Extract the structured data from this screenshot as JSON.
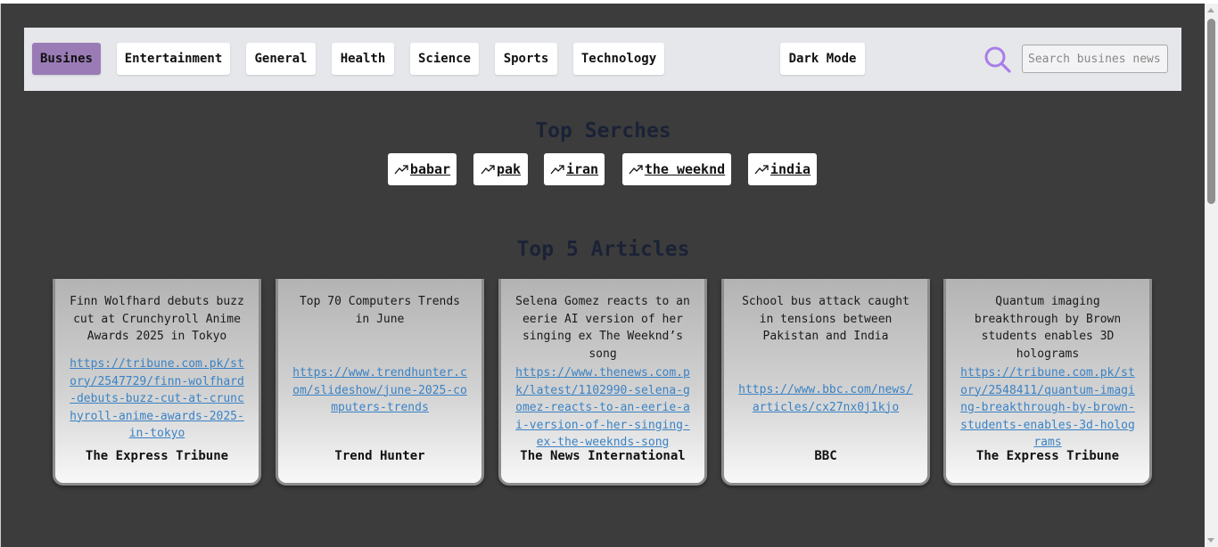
{
  "nav": {
    "categories": [
      "Busines",
      "Entertainment",
      "General",
      "Health",
      "Science",
      "Sports",
      "Technology"
    ],
    "active_category": "Busines",
    "dark_mode_label": "Dark Mode",
    "search_icon": "search-icon",
    "search_placeholder": "Search busines news",
    "active_color": "#9a7bb6"
  },
  "top_searches": {
    "title": "Top Serches",
    "icon": "trending-up-icon",
    "items": [
      "babar",
      "pak",
      "iran",
      "the weeknd",
      "india"
    ]
  },
  "articles": {
    "title": "Top 5 Articles",
    "items": [
      {
        "title": "Finn Wolfhard debuts buzz cut at Crunchyroll Anime Awards 2025 in Tokyo",
        "url": "https://tribune.com.pk/story/2547729/finn-wolfhard-debuts-buzz-cut-at-crunchyroll-anime-awards-2025-in-tokyo",
        "source": "The Express Tribune"
      },
      {
        "title": "Top 70 Computers Trends in June",
        "url": "https://www.trendhunter.com/slideshow/june-2025-computers-trends",
        "source": "Trend Hunter"
      },
      {
        "title": "Selena Gomez reacts to an eerie AI version of her singing ex The Weeknd’s song",
        "url": "https://www.thenews.com.pk/latest/1102990-selena-gomez-reacts-to-an-eerie-ai-version-of-her-singing-ex-the-weeknds-song",
        "source": "The News International"
      },
      {
        "title": "School bus attack caught in tensions between Pakistan and India",
        "url": "https://www.bbc.com/news/articles/cx27nx0j1kjo",
        "source": "BBC"
      },
      {
        "title": "Quantum imaging breakthrough by Brown students enables 3D holograms",
        "url": "https://tribune.com.pk/story/2548411/quantum-imaging-breakthrough-by-brown-students-enables-3d-holograms",
        "source": "The Express Tribune"
      }
    ]
  }
}
